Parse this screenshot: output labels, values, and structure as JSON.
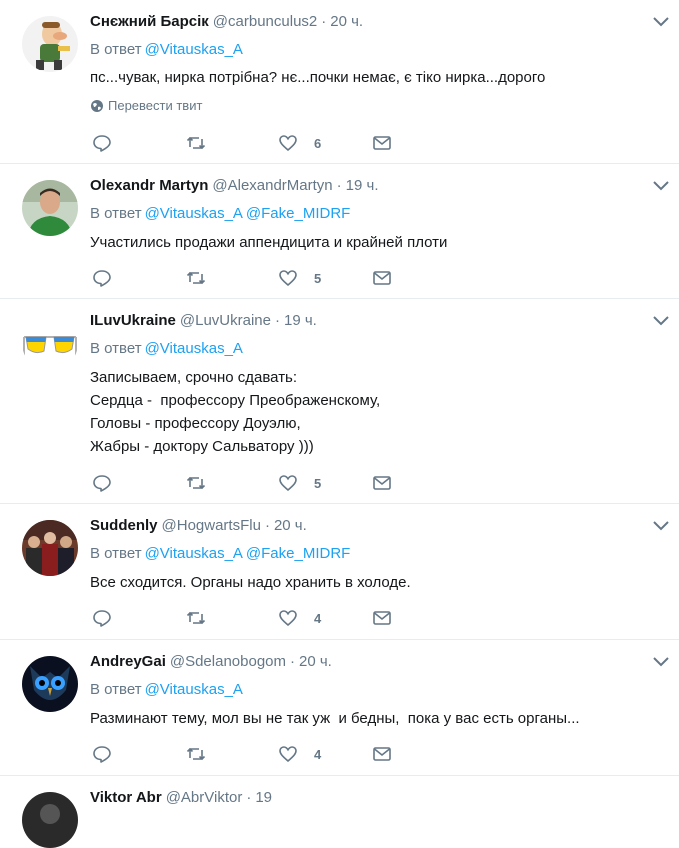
{
  "reply_prefix": "В ответ",
  "translate_label": "Перевести твит",
  "colors": {
    "accent": "#1da1f2",
    "secondary": "#657786",
    "divider": "#e6ecf0"
  },
  "icons": [
    "reply-icon",
    "retweet-icon",
    "like-icon",
    "message-icon",
    "chevron-down-icon",
    "globe-icon"
  ],
  "tweets": [
    {
      "name": "Снєжний Барсік",
      "handle": "@carbunculus2",
      "time": "20 ч.",
      "mentions": [
        "@Vitauskas_A"
      ],
      "text": "пс...чувак, нирка потрібна? нє...почки немає, є тіко нирка...дорого",
      "likes": "6",
      "avatar_icon": "cartoon-character-avatar"
    },
    {
      "name": "Olexandr Martyn",
      "handle": "@AlexandrMartyn",
      "time": "19 ч.",
      "mentions": [
        "@Vitauskas_A",
        "@Fake_MIDRF"
      ],
      "text": "Участились продажи аппендицита и крайней плоти",
      "likes": "5",
      "avatar_icon": "man-photo-avatar"
    },
    {
      "name": "ILuvUkraine",
      "handle": "@LuvUkraine",
      "time": "19 ч.",
      "mentions": [
        "@Vitauskas_A"
      ],
      "text": "Записываем, срочно сдавать:\nСердца -  профессору Преображенскому,\nГоловы - профессору Доуэлю,\nЖабры - доктору Сальватору )))",
      "likes": "5",
      "avatar_icon": "sunglasses-avatar"
    },
    {
      "name": "Suddenly",
      "handle": "@HogwartsFlu",
      "time": "20 ч.",
      "mentions": [
        "@Vitauskas_A",
        "@Fake_MIDRF"
      ],
      "text": "Все сходится. Органы надо хранить в холоде.",
      "likes": "4",
      "avatar_icon": "group-photo-avatar"
    },
    {
      "name": "AndreyGai",
      "handle": "@Sdelanobogom",
      "time": "20 ч.",
      "mentions": [
        "@Vitauskas_A"
      ],
      "text": "Разминают тему, мол вы не так уж  и бедны,  пока у вас есть органы...",
      "likes": "4",
      "avatar_icon": "owl-avatar"
    },
    {
      "name": "Viktor Abr",
      "handle": "@AbrViktor",
      "time": "19",
      "mentions": [],
      "text": "",
      "likes": "",
      "avatar_icon": "partial-avatar"
    }
  ]
}
